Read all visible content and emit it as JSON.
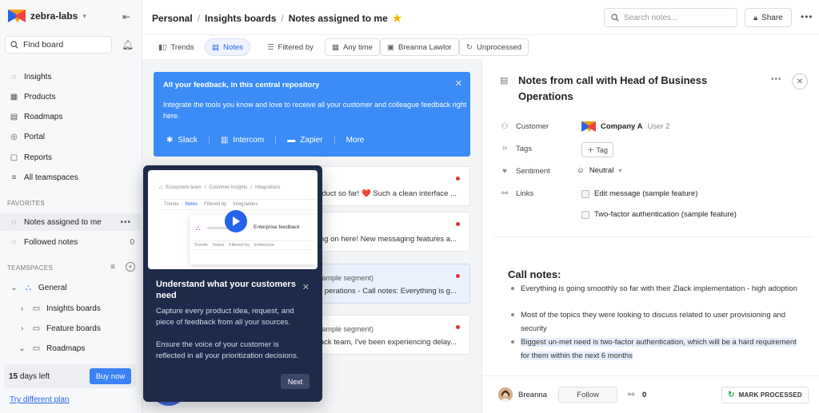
{
  "sidebar": {
    "workspace": "zebra-labs",
    "find_board": "Find board",
    "nav": [
      {
        "label": "Insights",
        "icon": "bulb-icon"
      },
      {
        "label": "Products",
        "icon": "grid-icon"
      },
      {
        "label": "Roadmaps",
        "icon": "map-icon"
      },
      {
        "label": "Portal",
        "icon": "portal-icon"
      },
      {
        "label": "Reports",
        "icon": "report-icon"
      },
      {
        "label": "All teamspaces",
        "icon": "teamspaces-icon"
      }
    ],
    "favorites_label": "FAVORITES",
    "favorites": [
      {
        "label": "Notes assigned to me",
        "active": true
      },
      {
        "label": "Followed notes",
        "count": "0"
      }
    ],
    "teamspaces_label": "TEAMSPACES",
    "teamspaces": [
      {
        "label": "General"
      },
      {
        "label": "Insights boards"
      },
      {
        "label": "Feature boards"
      },
      {
        "label": "Roadmaps"
      }
    ],
    "trial_days": "15",
    "trial_suffix": " days left",
    "buy_now": "Buy now",
    "try_plan": "Try different plan"
  },
  "header": {
    "breadcrumbs": [
      "Personal",
      "Insights boards",
      "Notes assigned to me"
    ],
    "search_placeholder": "Search notes...",
    "share": "Share"
  },
  "toolbar": {
    "trends": "Trends",
    "notes": "Notes",
    "filtered_by": "Filtered by",
    "time": "Any time",
    "person": "Breanna Lawlor",
    "status": "Unprocessed"
  },
  "banner": {
    "title": "All your feedback, in this central repository",
    "body": "Integrate the tools you know and love to receive all your customer and colleague feedback right here.",
    "tools": [
      "Slack",
      "Intercom",
      "Zapier",
      "More"
    ]
  },
  "cards": [
    {
      "header": "",
      "text": "oduct so far! ❤️ Such a clean interface ..."
    },
    {
      "header": "",
      "text": "ng on here! New messaging features a..."
    },
    {
      "header": "sample segment)",
      "text": "perations - Call notes: Everything is g..."
    },
    {
      "header": "sample segment)",
      "text": "ack team, I've been experiencing delay..."
    }
  ],
  "onboarding": {
    "preview": {
      "crumb1": "Ecosystem team",
      "crumb2": "Customer insights",
      "crumb3": "Integrations",
      "trends": "Trends",
      "notes": "Notes",
      "filtered_by": "Filtered by",
      "integrations": "Integrations",
      "enterprise_feedback": "Enterprise feedback",
      "enterprise": "Enterprise"
    },
    "title": "Understand what your customers need",
    "p1": "Capture every product idea, request, and piece of feedback from all your sources.",
    "p2": "Ensure the voice of your customer is reflected in all your prioritization decisions.",
    "next": "Next"
  },
  "detail": {
    "title": "Notes from call with Head of Business Operations",
    "customer_label": "Customer",
    "company": "Company A",
    "user": "User 2",
    "tags_label": "Tags",
    "tag_btn": "Tag",
    "sentiment_label": "Sentiment",
    "sentiment": "Neutral",
    "links_label": "Links",
    "links": [
      "Edit message (sample feature)",
      "Two-factor authentication (sample feature)"
    ],
    "notes_heading": "Call notes:",
    "bullets": [
      "Everything is going smoothly so far with their Zlack implementation - high adoption",
      "Most of the topics they were looking to discuss related to user provisioning and security",
      "Biggest un-met need is two-factor authentication, which will be a hard requirement for them within the next 6 months"
    ],
    "owner": "Breanna",
    "follow": "Follow",
    "links_count": "0",
    "mark_processed": "MARK PROCESSED"
  },
  "colors": {
    "accent": "#3b82f6",
    "banner": "#3b8cf6",
    "overlay": "#1e2a4a",
    "red_dot": "#e03131"
  }
}
